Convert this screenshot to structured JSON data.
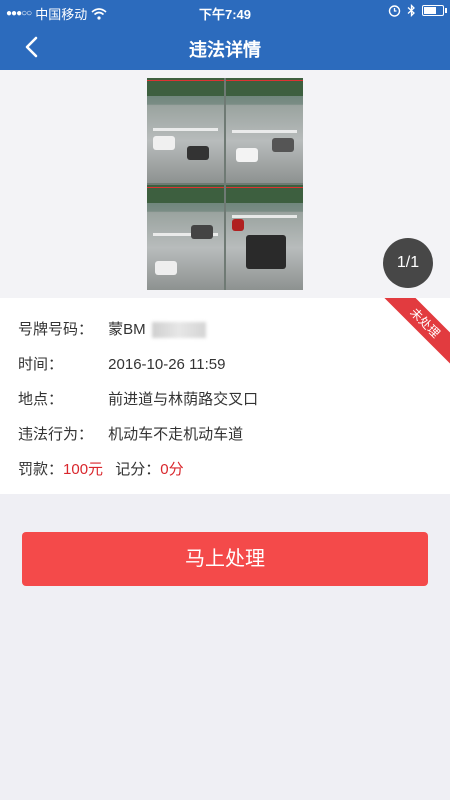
{
  "status_bar": {
    "signal_dots": "●●●○○",
    "carrier": "中国移动",
    "time": "下午7:49",
    "icons": [
      "wifi-icon",
      "alarm-icon",
      "bluetooth-icon",
      "battery-icon"
    ]
  },
  "nav": {
    "title": "违法详情",
    "back_icon": "chevron-left-icon"
  },
  "photo": {
    "page_indicator": "1/1"
  },
  "status_ribbon": "未处理",
  "details": {
    "plate_label": "号牌号码：",
    "plate_value": "蒙BM",
    "time_label": "时间：",
    "time_value": "2016-10-26 11:59",
    "location_label": "地点：",
    "location_value": "前进道与林荫路交叉口",
    "behavior_label": "违法行为：",
    "behavior_value": "机动车不走机动车道",
    "fine_label": "罚款：",
    "fine_value": "100元",
    "points_label": "记分：",
    "points_value": "0分"
  },
  "action_button": "马上处理",
  "colors": {
    "primary": "#2c6bbd",
    "accent_red": "#d9262c",
    "button_red": "#f44a4a",
    "background": "#efeff4"
  }
}
